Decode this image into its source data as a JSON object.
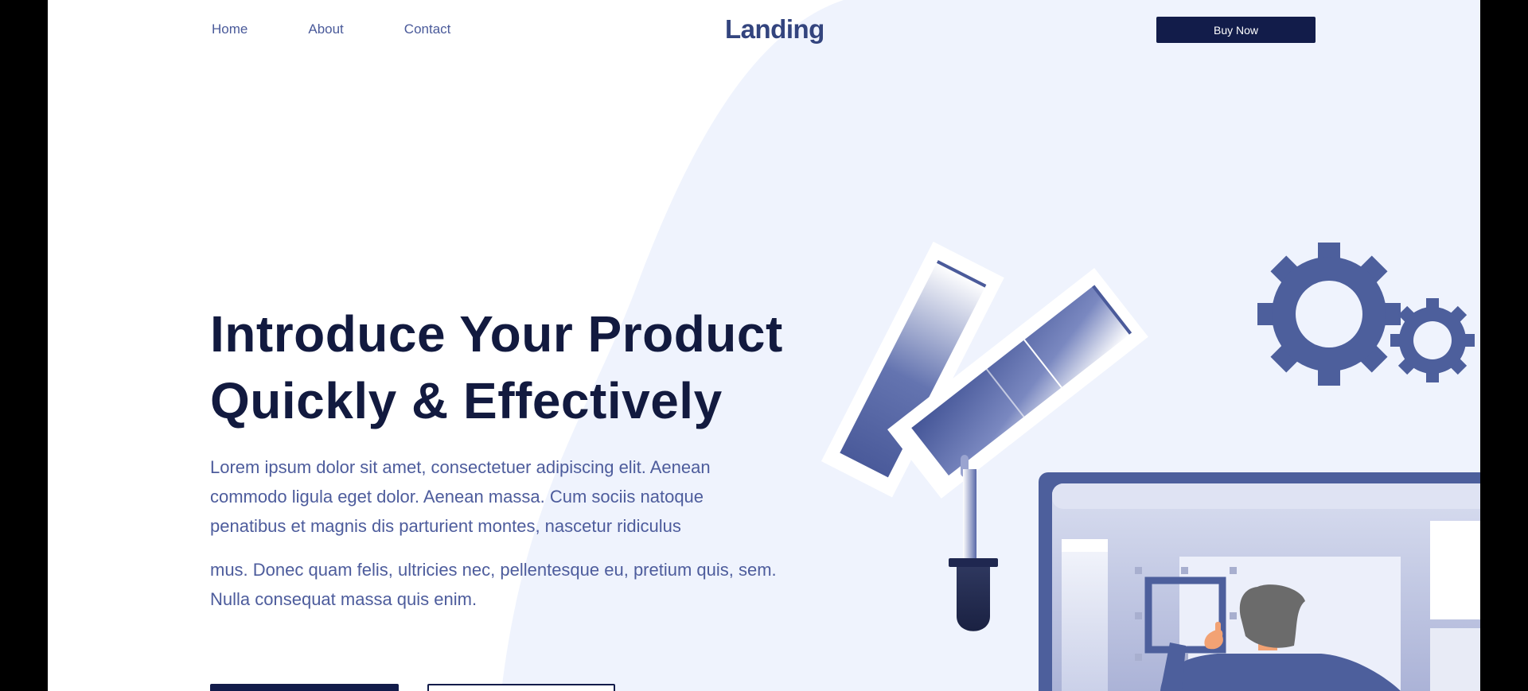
{
  "nav": {
    "items": [
      {
        "label": "Home"
      },
      {
        "label": "About"
      },
      {
        "label": "Contact"
      }
    ]
  },
  "brand": {
    "logo_text": "Landing"
  },
  "header": {
    "buy_label": "Buy Now"
  },
  "hero": {
    "title_line1": "Introduce Your Product",
    "title_line2": "Quickly & Effectively",
    "paragraph1": "Lorem ipsum dolor sit amet, consectetuer adipiscing elit. Aenean commodo ligula eget dolor. Aenean massa. Cum sociis natoque penatibus et magnis dis parturient montes, nascetur ridiculus",
    "paragraph2": "mus. Donec quam felis, ultricies nec, pellentesque eu, pretium quis, sem. Nulla consequat massa quis enim."
  },
  "colors": {
    "accent_dark": "#121c4a",
    "accent_blue": "#4d5f9c",
    "background_blob": "#eff3fd"
  },
  "icons": [
    "gear-icon",
    "color-swatch-icon",
    "eyedropper-icon",
    "monitor-icon",
    "person-icon"
  ]
}
